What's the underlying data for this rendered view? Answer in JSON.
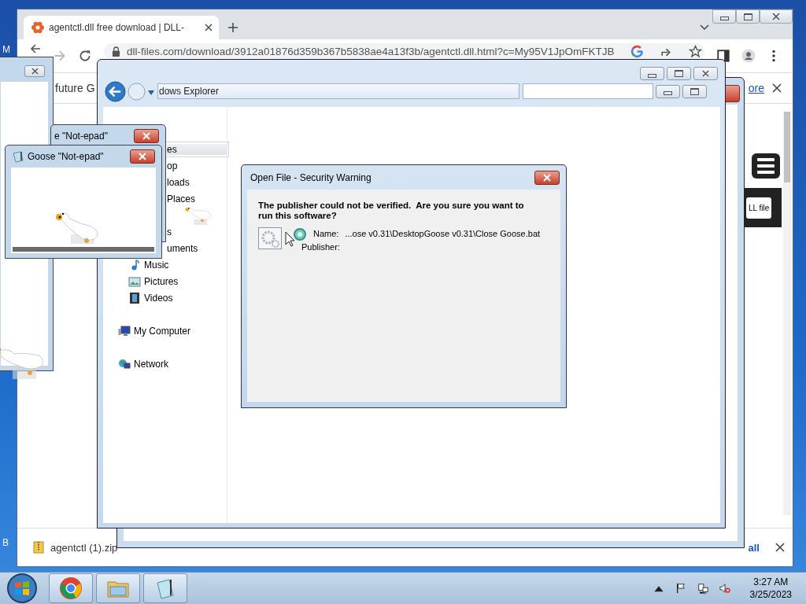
{
  "desktop_labels": [
    "M",
    "B"
  ],
  "browser": {
    "tab_title": "agentctl.dll free download | DLL-",
    "address": "dll-files.com/download/3912a01876d359b367b5838ae4a13f3b/agentctl.dll.html?c=My95V1JpOmFKTJB",
    "infobar_text": "future G",
    "infobar_link": "ore",
    "page_button": "LL file",
    "download_file": "agentctl (1).zip",
    "download_link": "all"
  },
  "left_window": {
    "kind": "blank"
  },
  "explorer": {
    "address": "dows Explorer",
    "sidebar": [
      {
        "label": "es",
        "kind": "covered",
        "selected": true,
        "children": [
          {
            "label": "op",
            "kind": "covered",
            "selected": false
          },
          {
            "label": "loads",
            "kind": "covered",
            "selected": false
          },
          {
            "label": "Places",
            "kind": "covered",
            "selected": false
          }
        ]
      },
      {
        "label": "s",
        "kind": "covered",
        "selected": false,
        "children": [
          {
            "label": "uments",
            "kind": "covered",
            "selected": false
          },
          {
            "label": "Music",
            "kind": "music",
            "selected": false
          },
          {
            "label": "Pictures",
            "kind": "pictures",
            "selected": false
          },
          {
            "label": "Videos",
            "kind": "videos",
            "selected": false
          }
        ]
      },
      {
        "label": "My Computer",
        "kind": "computer",
        "selected": false
      },
      {
        "label": "Network",
        "kind": "network",
        "selected": false
      }
    ]
  },
  "goose_windows": [
    {
      "title": "e \"Not-epad\""
    },
    {
      "title": "Goose \"Not-epad\""
    }
  ],
  "dialog": {
    "title": "Open File - Security Warning",
    "message": "The publisher could not be verified.  Are you sure you want to run this software?",
    "name_label": "Name:",
    "name_value": "...ose v0.31\\DesktopGoose v0.31\\Close Goose.bat",
    "publisher_label": "Publisher:"
  },
  "taskbar": {
    "time": "3:27 AM",
    "date": "3/25/2023"
  }
}
